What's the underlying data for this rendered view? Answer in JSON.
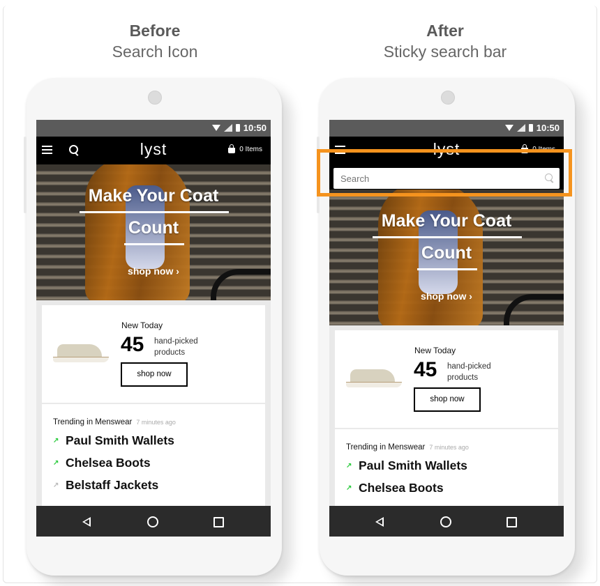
{
  "before": {
    "title": "Before",
    "subtitle": "Search Icon"
  },
  "after": {
    "title": "After",
    "subtitle": "Sticky search bar"
  },
  "status": {
    "time": "10:50"
  },
  "app": {
    "logo": "lyst",
    "bag_label": "0 Items",
    "search_placeholder": "Search"
  },
  "hero": {
    "line1": "Make Your Coat",
    "line2": "Count",
    "cta": "shop now ›"
  },
  "promo": {
    "new_today": "New Today",
    "count": "45",
    "hp_line1": "hand-picked",
    "hp_line2": "products",
    "button": "shop now"
  },
  "trending": {
    "label": "Trending in Menswear",
    "ago": "7 minutes ago",
    "items": [
      {
        "name": "Paul Smith Wallets",
        "arrow": "↗",
        "arrow_color": "#2ecc40"
      },
      {
        "name": "Chelsea Boots",
        "arrow": "↗",
        "arrow_color": "#2ecc40"
      },
      {
        "name": "Belstaff Jackets",
        "arrow": "↗",
        "arrow_color": "#bbbbbb"
      }
    ]
  },
  "colors": {
    "highlight": "#f5931e",
    "appbar": "#000000",
    "navbar": "#2b2b2b"
  }
}
